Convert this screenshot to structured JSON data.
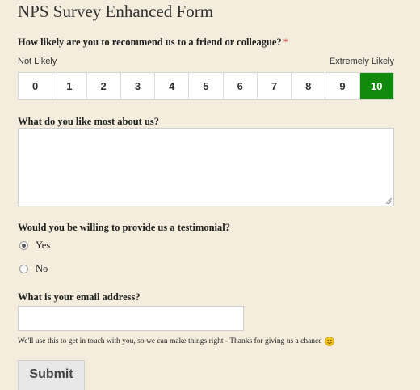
{
  "form": {
    "title": "NPS Survey Enhanced Form"
  },
  "nps": {
    "question": "How likely are you to recommend us to a friend or colleague?",
    "required_marker": "*",
    "low_label": "Not Likely",
    "high_label": "Extremely Likely",
    "options": [
      "0",
      "1",
      "2",
      "3",
      "4",
      "5",
      "6",
      "7",
      "8",
      "9",
      "10"
    ],
    "selected": "10",
    "selected_color": "#118a0c"
  },
  "likes": {
    "question": "What do you like most about us?",
    "value": ""
  },
  "testimonial": {
    "question": "Would you be willing to provide us a testimonial?",
    "options": [
      "Yes",
      "No"
    ],
    "selected": "Yes"
  },
  "email": {
    "question": "What is your email address?",
    "value": "",
    "helper": "We'll use this to get in touch with you, so we can make things right - Thanks for giving us a chance",
    "helper_icon": "smiley-emoji-icon"
  },
  "submit": {
    "label": "Submit"
  }
}
